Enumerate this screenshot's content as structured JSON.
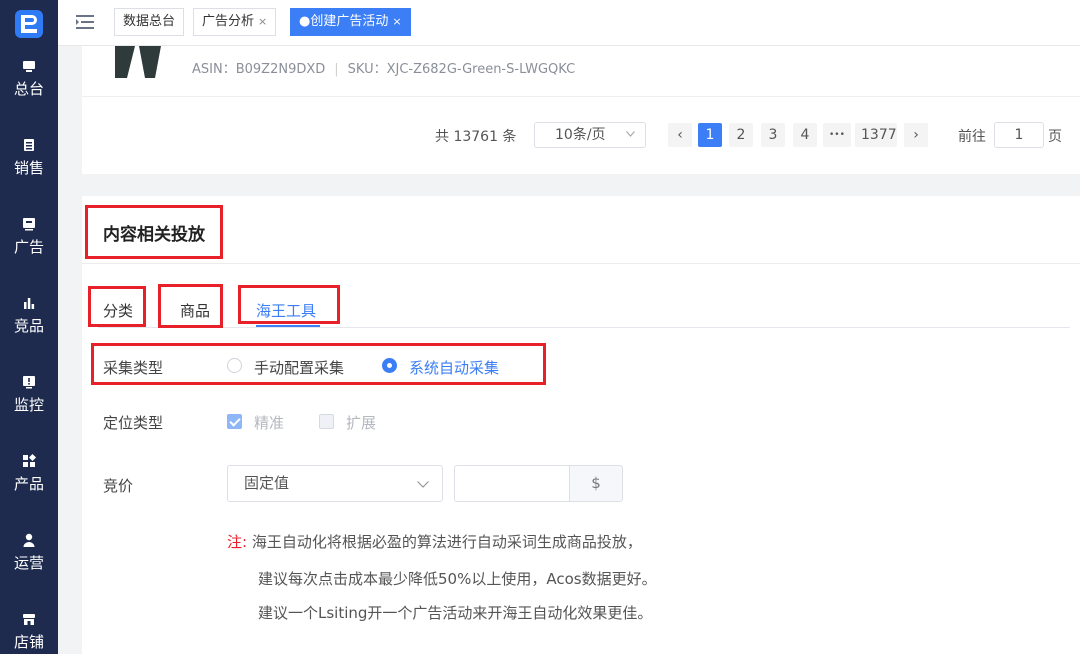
{
  "sidebar": {
    "logo": "logo-icon",
    "items": [
      {
        "label": "总台",
        "icon": "monitor-icon"
      },
      {
        "label": "销售",
        "icon": "list-icon"
      },
      {
        "label": "广告",
        "icon": "ad-icon"
      },
      {
        "label": "竞品",
        "icon": "bar-chart-icon"
      },
      {
        "label": "监控",
        "icon": "alert-icon"
      },
      {
        "label": "产品",
        "icon": "grid-icon"
      },
      {
        "label": "运营",
        "icon": "user-icon"
      },
      {
        "label": "店铺",
        "icon": "store-icon"
      }
    ]
  },
  "topbar": {
    "tabs": [
      {
        "label": "数据总台"
      },
      {
        "label": "广告分析",
        "close": "×"
      },
      {
        "label": "●创建广告活动",
        "close": "×"
      }
    ]
  },
  "product": {
    "asin": "ASIN：B09Z2N9DXD",
    "sep": "|",
    "sku": "SKU：XJC-Z682G-Green-S-LWGQKC"
  },
  "pagination": {
    "total": "共 13761 条",
    "page_size": "10条/页",
    "prev": "‹",
    "pages": [
      "1",
      "2",
      "3",
      "4",
      "•••",
      "1377"
    ],
    "next": "›",
    "goto_prefix": "前往",
    "goto_value": "1",
    "goto_suffix": "页"
  },
  "section": {
    "title": "内容相关投放",
    "tabs": [
      {
        "label": "分类"
      },
      {
        "label": "商品"
      },
      {
        "label": "海王工具"
      }
    ],
    "collect": {
      "label": "采集类型",
      "options": [
        "手动配置采集",
        "系统自动采集"
      ]
    },
    "targeting": {
      "label": "定位类型",
      "options": [
        "精准",
        "扩展"
      ]
    },
    "bid": {
      "label": "竞价",
      "select_value": "固定值",
      "unit": "$"
    },
    "notes": {
      "prefix": "注:",
      "line1": "海王自动化将根据必盈的算法进行自动采词生成商品投放，",
      "line2": "建议每次点击成本最少降低50%以上使用，Acos数据更好。",
      "line3": "建议一个Lsiting开一个广告活动来开海王自动化效果更佳。"
    }
  },
  "colors": {
    "sidebar_bg": "#1e2b4e",
    "accent": "#3b7ef5",
    "highlight_box": "#e8202a"
  }
}
